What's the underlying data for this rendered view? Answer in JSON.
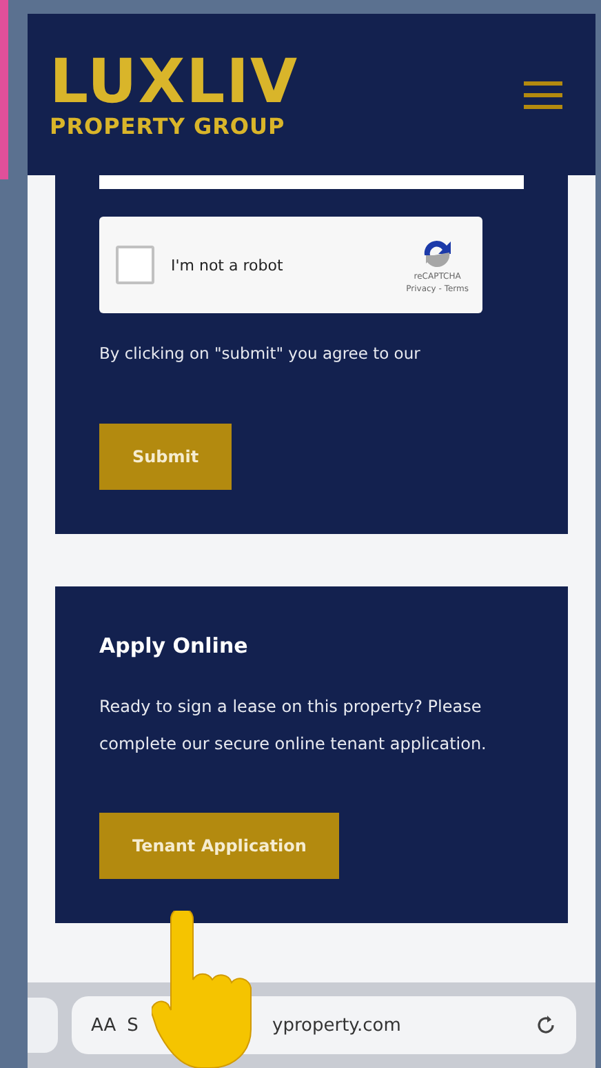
{
  "header": {
    "logo_main": "LUXLIV",
    "logo_sub": "PROPERTY GROUP"
  },
  "form_card": {
    "captcha": {
      "label": "I'm not a robot",
      "checked": false,
      "brand": "reCAPTCHA",
      "links": "Privacy - Terms"
    },
    "consent": "By clicking on \"submit\" you agree to our",
    "button": "Submit"
  },
  "apply_card": {
    "title": "Apply Online",
    "text": "Ready to sign a lease on this property? Please complete our secure online tenant application.",
    "button": "Tenant Application"
  },
  "browser_bar": {
    "text_size": "AA",
    "url_start": "S",
    "url_end": "yproperty.com"
  }
}
